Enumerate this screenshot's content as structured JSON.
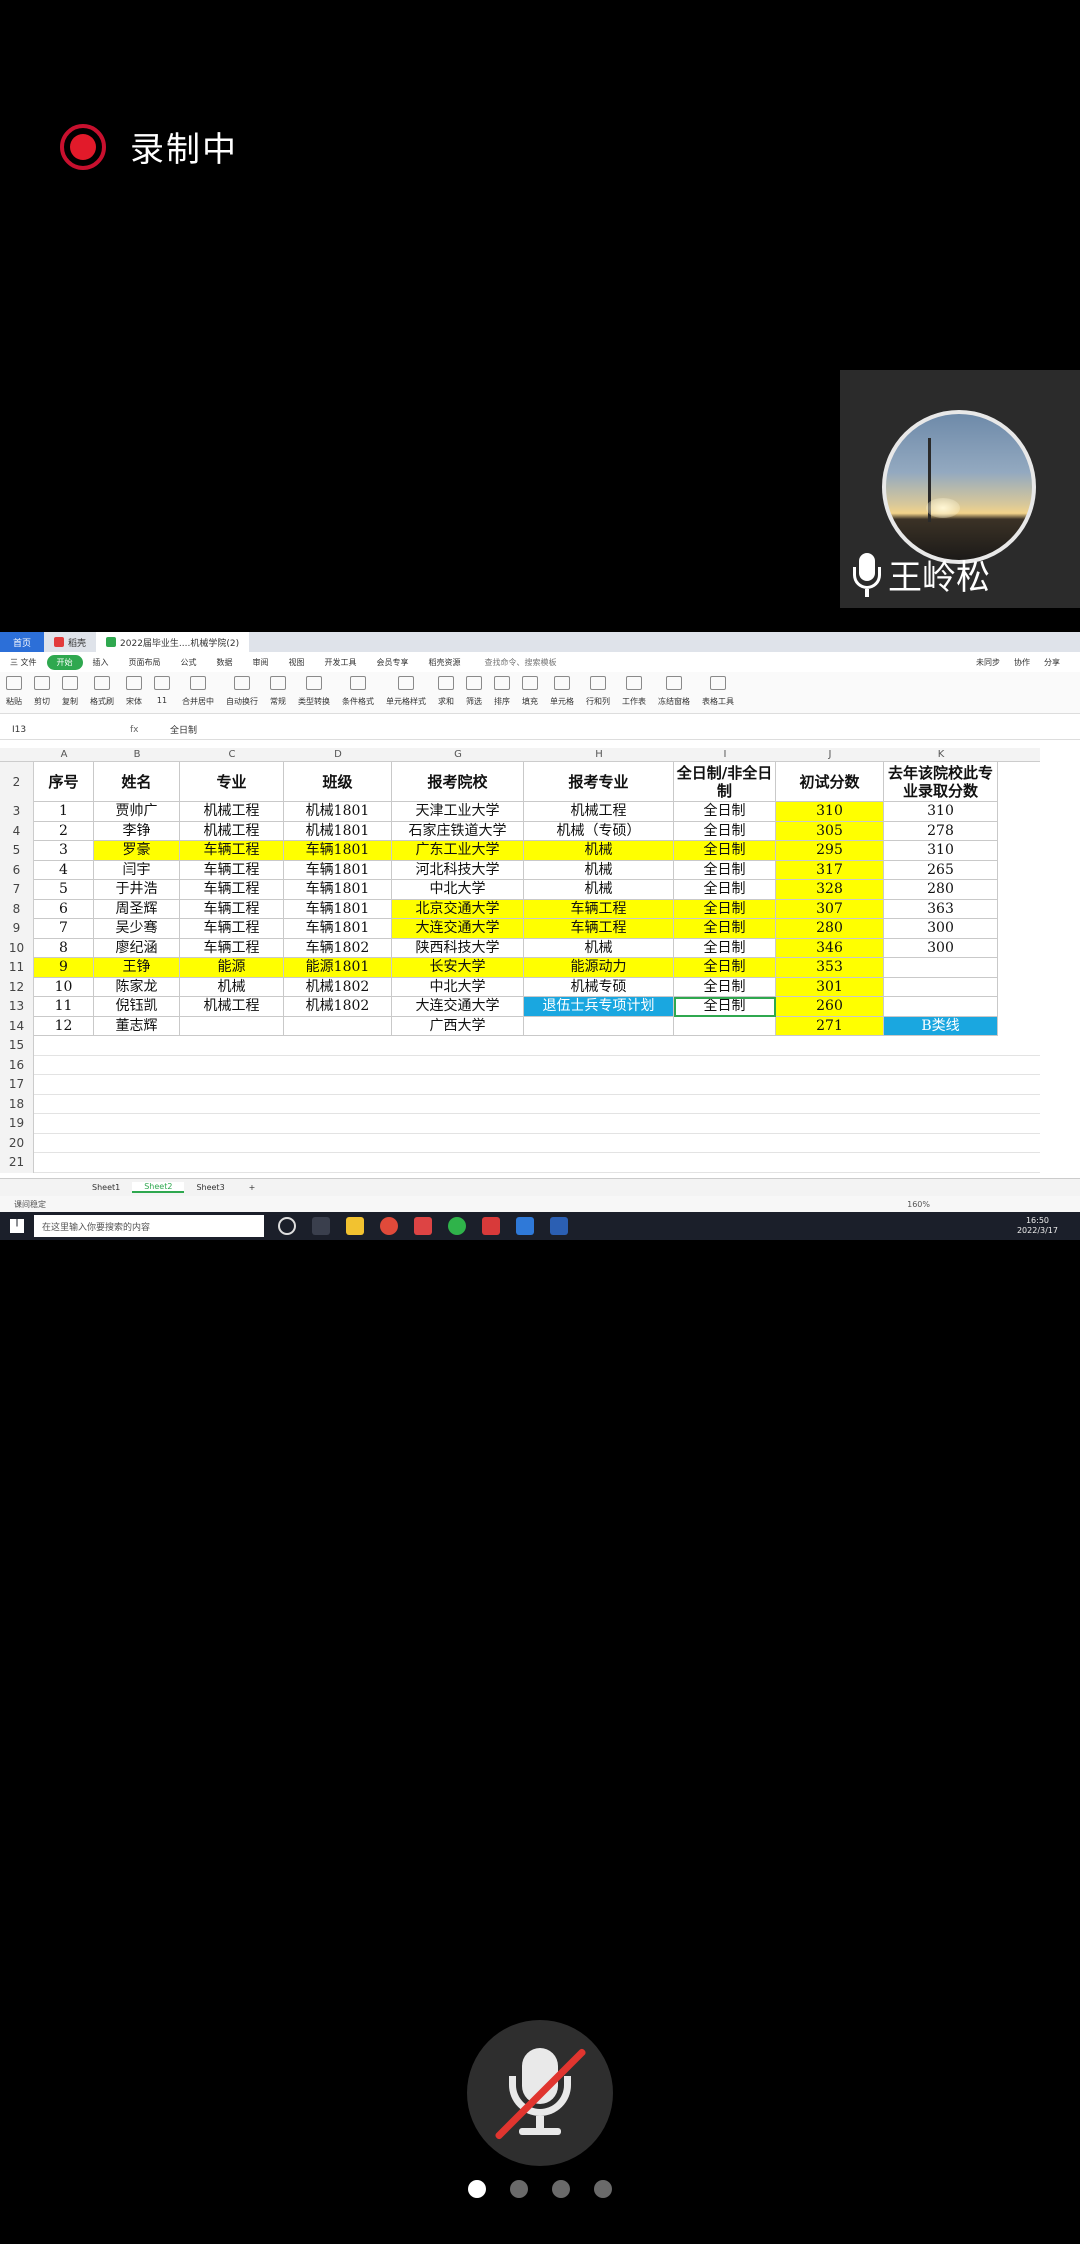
{
  "recording": {
    "label": "录制中"
  },
  "participant": {
    "name": "王岭松"
  },
  "screen": {
    "tabs": [
      "首页",
      "稻壳",
      "2022届毕业生....机械学院(2)"
    ],
    "menu": [
      "三 文件",
      "开始",
      "插入",
      "页面布局",
      "公式",
      "数据",
      "审阅",
      "视图",
      "开发工具",
      "会员专享",
      "稻壳资源"
    ],
    "search_hint": "查找命令、搜索模板",
    "menu_right": [
      "未同步",
      "协作",
      "分享"
    ],
    "ribbon": [
      "粘贴",
      "剪切",
      "复制",
      "格式刷",
      "宋体",
      "11",
      "合并居中",
      "自动换行",
      "常规",
      "类型转换",
      "条件格式",
      "单元格样式",
      "求和",
      "筛选",
      "排序",
      "填充",
      "单元格",
      "行和列",
      "工作表",
      "冻结窗格",
      "表格工具"
    ],
    "name_box": "I13",
    "formula_value": "全日制",
    "columns": [
      "A",
      "B",
      "C",
      "D",
      "G",
      "H",
      "I",
      "J",
      "K"
    ],
    "row_numbers": [
      "2",
      "3",
      "4",
      "5",
      "6",
      "7",
      "8",
      "9",
      "10",
      "11",
      "12",
      "13",
      "14",
      "15",
      "16",
      "17",
      "18",
      "19",
      "20",
      "21"
    ],
    "table": {
      "headers": [
        "序号",
        "姓名",
        "专业",
        "班级",
        "报考院校",
        "报考专业",
        "全日制/非全日制",
        "初试分数",
        "去年该院校此专业录取分数"
      ],
      "rows": [
        [
          "1",
          "贾帅广",
          "机械工程",
          "机械1801",
          "天津工业大学",
          "机械工程",
          "全日制",
          "310",
          "310"
        ],
        [
          "2",
          "李铮",
          "机械工程",
          "机械1801",
          "石家庄铁道大学",
          "机械（专硕）",
          "全日制",
          "305",
          "278"
        ],
        [
          "3",
          "罗豪",
          "车辆工程",
          "车辆1801",
          "广东工业大学",
          "机械",
          "全日制",
          "295",
          "310"
        ],
        [
          "4",
          "闫宇",
          "车辆工程",
          "车辆1801",
          "河北科技大学",
          "机械",
          "全日制",
          "317",
          "265"
        ],
        [
          "5",
          "于井浩",
          "车辆工程",
          "车辆1801",
          "中北大学",
          "机械",
          "全日制",
          "328",
          "280"
        ],
        [
          "6",
          "周圣辉",
          "车辆工程",
          "车辆1801",
          "北京交通大学",
          "车辆工程",
          "全日制",
          "307",
          "363"
        ],
        [
          "7",
          "吴少骞",
          "车辆工程",
          "车辆1801",
          "大连交通大学",
          "车辆工程",
          "全日制",
          "280",
          "300"
        ],
        [
          "8",
          "廖纪涵",
          "车辆工程",
          "车辆1802",
          "陕西科技大学",
          "机械",
          "全日制",
          "346",
          "300"
        ],
        [
          "9",
          "王铮",
          "能源",
          "能源1801",
          "长安大学",
          "能源动力",
          "全日制",
          "353",
          ""
        ],
        [
          "10",
          "陈家龙",
          "机械",
          "机械1802",
          "中北大学",
          "机械专硕",
          "全日制",
          "301",
          ""
        ],
        [
          "11",
          "倪钰凯",
          "机械工程",
          "机械1802",
          "大连交通大学",
          "退伍士兵专项计划",
          "全日制",
          "260",
          ""
        ],
        [
          "12",
          "董志辉",
          "",
          "",
          "广西大学",
          "",
          "",
          "271",
          "B类线"
        ]
      ]
    },
    "sheets": [
      "Sheet1",
      "Sheet2",
      "Sheet3"
    ],
    "status_left": "课间稳定",
    "zoom": "160%",
    "taskbar_search": "在这里输入你要搜索的内容",
    "clock_time": "16:50",
    "clock_date": "2022/3/17",
    "colors": {
      "highlight": "#ffff00",
      "blue_cell": "#1aa7e0",
      "accent": "#2fa84f"
    }
  }
}
